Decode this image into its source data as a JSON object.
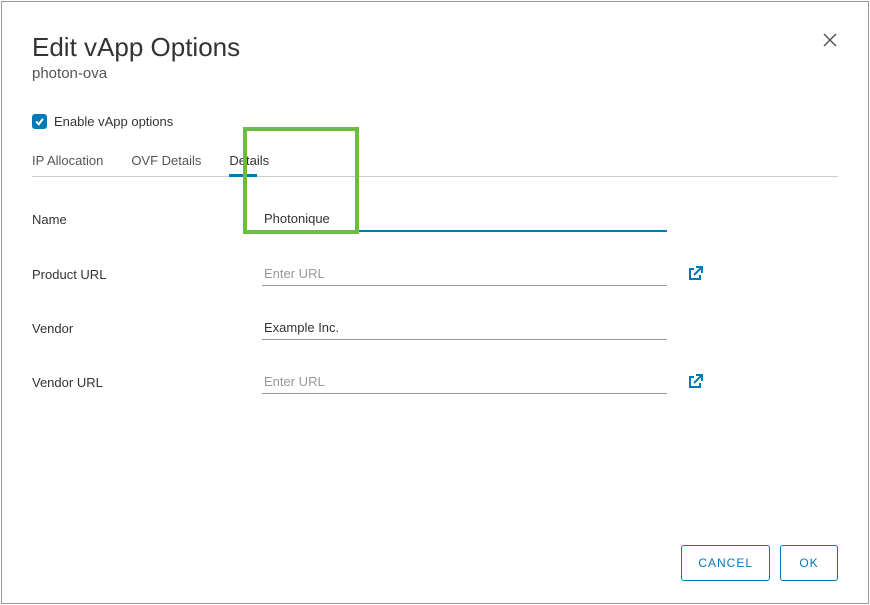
{
  "dialog": {
    "title": "Edit vApp Options",
    "subtitle": "photon-ova",
    "checkbox_label": "Enable vApp options"
  },
  "tabs": {
    "items": [
      {
        "label": "IP Allocation"
      },
      {
        "label": "OVF Details"
      },
      {
        "label": "Details"
      }
    ],
    "active_index": 2
  },
  "fields": {
    "name": {
      "label": "Name",
      "value": "Photonique",
      "placeholder": ""
    },
    "product_url": {
      "label": "Product URL",
      "value": "",
      "placeholder": "Enter URL"
    },
    "vendor": {
      "label": "Vendor",
      "value": "Example Inc.",
      "placeholder": ""
    },
    "vendor_url": {
      "label": "Vendor URL",
      "value": "",
      "placeholder": "Enter URL"
    }
  },
  "footer": {
    "cancel_label": "CANCEL",
    "ok_label": "OK"
  }
}
